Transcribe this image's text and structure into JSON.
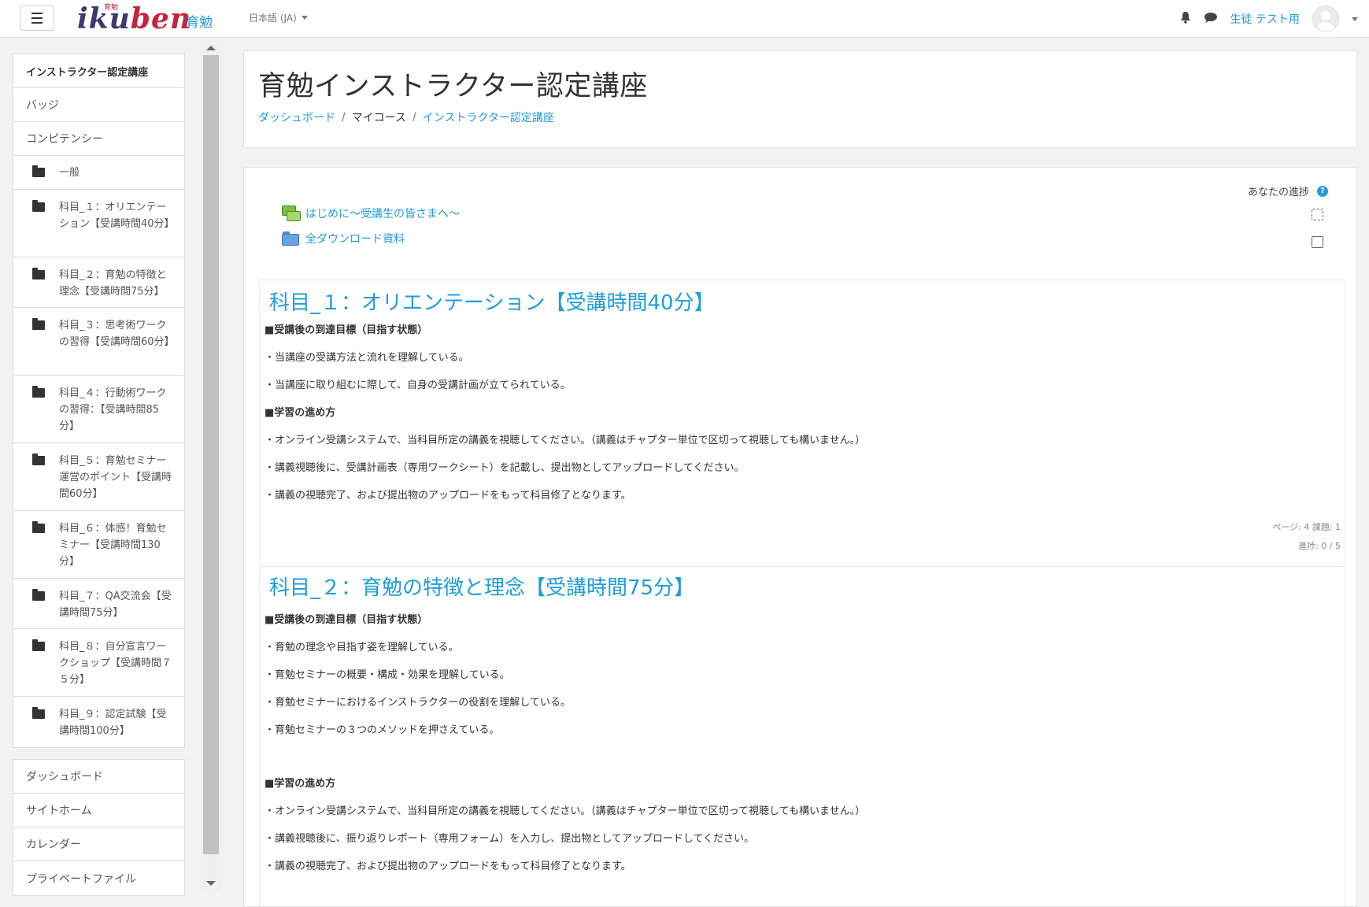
{
  "navbar": {
    "menu_label": "≡",
    "logo_text_1": "iku",
    "logo_text_2": "ben",
    "logo_small": "育勉",
    "logo_ja": "育勉",
    "language": "日本語 (JA)",
    "user_name": "生徒 テスト用"
  },
  "sidebar": {
    "course_nav": [
      {
        "label": "インストラクター認定講座"
      },
      {
        "label": "バッジ"
      },
      {
        "label": "コンピテンシー"
      }
    ],
    "sections": [
      {
        "label": "一般"
      },
      {
        "label": "科目_１：オリエンテーション【受講時間40分】"
      },
      {
        "label": "科目_２：育勉の特徴と理念【受講時間75分】"
      },
      {
        "label": "科目_３：思考術ワークの習得【受講時間60分】"
      },
      {
        "label": "科目_４：行動術ワークの習得：【受講時間85分】"
      },
      {
        "label": "科目_５：育勉セミナー運営のポイント【受講時間60分】"
      },
      {
        "label": "科目_６：体感！育勉セミナー【受講時間130分】"
      },
      {
        "label": "科目_７：QA交流会【受講時間75分】"
      },
      {
        "label": "科目_８：自分宣言ワークショップ【受講時間７５分】"
      },
      {
        "label": "科目_９：認定試験【受講時間100分】"
      }
    ],
    "site_nav": [
      {
        "label": "ダッシュボード"
      },
      {
        "label": "サイトホーム"
      },
      {
        "label": "カレンダー"
      },
      {
        "label": "プライベートファイル"
      }
    ]
  },
  "header": {
    "title": "育勉インストラクター認定講座",
    "breadcrumb": [
      {
        "label": "ダッシュボード"
      },
      {
        "label": "マイコース"
      },
      {
        "label": "インストラクター認定講座"
      }
    ],
    "breadcrumb_sep": "/"
  },
  "main": {
    "progress_label": "あなたの進捗",
    "help_glyph": "?",
    "activities": [
      {
        "label": "はじめに～受講生の皆さまへ～",
        "icon": "forum-icon"
      },
      {
        "label": "全ダウンロード資料",
        "icon": "folder-icon"
      }
    ],
    "sections": [
      {
        "title": "科目_１：オリエンテーション【受講時間40分】",
        "lines": [
          "■受講後の到達目標（目指す状態）",
          "・当講座の受講方法と流れを理解している。",
          "・当講座に取り組むに際して、自身の受講計画が立てられている。",
          "■学習の進め方",
          "・オンライン受講システムで、当科目所定の講義を視聴してください。（講義はチャプター単位で区切って視聴しても構いません。）",
          "・講義視聴後に、受講計画表（専用ワークシート）を記載し、提出物としてアップロードしてください。",
          "・講義の視聴完了、および提出物のアップロードをもって科目修了となります。"
        ],
        "meta_1": "ページ: 4  課題: 1",
        "meta_2": "進捗: 0 / 5"
      },
      {
        "title": "科目_２：育勉の特徴と理念【受講時間75分】",
        "lines": [
          "■受講後の到達目標（目指す状態）",
          "・育勉の理念や目指す姿を理解している。",
          "・育勉セミナーの概要・構成・効果を理解している。",
          "・育勉セミナーにおけるインストラクターの役割を理解している。",
          "・育勉セミナーの３つのメソッドを押さえている。",
          "■学習の進め方",
          "・オンライン受講システムで、当科目所定の講義を視聴してください。（講義はチャプター単位で区切って視聴しても構いません。）",
          "・講義視聴後に、振り返りレポート（専用フォーム）を入力し、提出物としてアップロードしてください。",
          "・講義の視聴完了、および提出物のアップロードをもって科目修了となります。"
        ]
      }
    ]
  },
  "colors": {
    "link": "#1f9ed8",
    "logo_navy": "#3d3a6e",
    "logo_red": "#c8233c"
  }
}
